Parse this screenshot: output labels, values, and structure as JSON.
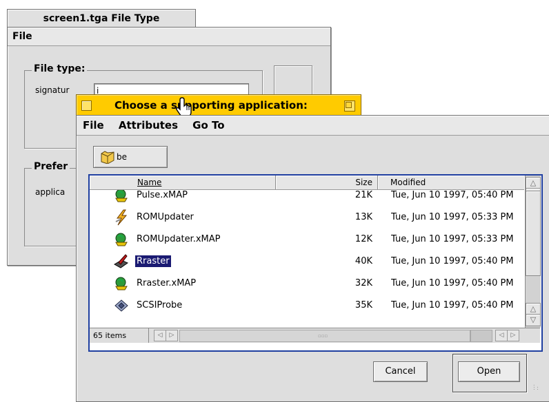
{
  "back_window": {
    "title": "screen1.tga File Type",
    "menu": [
      "File"
    ],
    "file_type_label": "File type:",
    "signature_label": "signatur",
    "signature_value": "i",
    "preferred_label": "Prefer",
    "application_label": "applica"
  },
  "dialog": {
    "title": "Choose a supporting application:",
    "menu": [
      "File",
      "Attributes",
      "Go To"
    ],
    "path": "be",
    "columns": {
      "name": "Name",
      "size": "Size",
      "modified": "Modified"
    },
    "files": [
      {
        "name": "Pulse.xMAP",
        "size": "21K",
        "modified": "Tue, Jun 10 1997, 05:40 PM",
        "icon": "globe-map-icon",
        "selected": false
      },
      {
        "name": "ROMUpdater",
        "size": "13K",
        "modified": "Tue, Jun 10 1997, 05:33 PM",
        "icon": "lightning-app-icon",
        "selected": false
      },
      {
        "name": "ROMUpdater.xMAP",
        "size": "12K",
        "modified": "Tue, Jun 10 1997, 05:33 PM",
        "icon": "globe-map-icon",
        "selected": false
      },
      {
        "name": "Rraster",
        "size": "40K",
        "modified": "Tue, Jun 10 1997, 05:40 PM",
        "icon": "paint-app-icon",
        "selected": true
      },
      {
        "name": "Rraster.xMAP",
        "size": "32K",
        "modified": "Tue, Jun 10 1997, 05:40 PM",
        "icon": "globe-map-icon",
        "selected": false
      },
      {
        "name": "SCSIProbe",
        "size": "35K",
        "modified": "Tue, Jun 10 1997, 05:40 PM",
        "icon": "scsi-app-icon",
        "selected": false
      }
    ],
    "item_count": "65 items",
    "cancel_label": "Cancel",
    "open_label": "Open"
  },
  "colors": {
    "title_tab_active": "#ffcb00",
    "selection": "#1a1a72",
    "list_focus_border": "#1f3fa0",
    "window_bg": "#dedede"
  }
}
